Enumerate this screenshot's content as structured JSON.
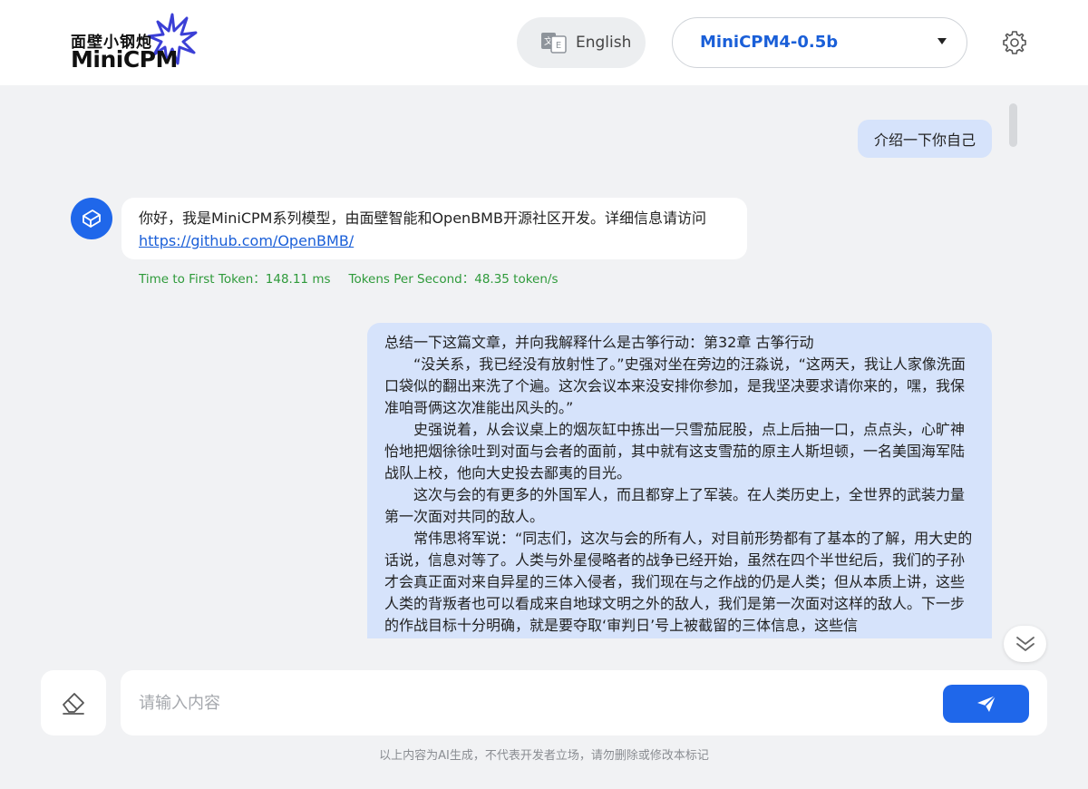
{
  "header": {
    "logo_cn": "面壁小钢炮",
    "logo_en": "MiniCPM",
    "language_label": "English",
    "model_value": "MiniCPM4-0.5b"
  },
  "chat": {
    "user_message_1": "介绍一下你自己",
    "bot_reply_text": "你好，我是MiniCPM系列模型，由面壁智能和OpenBMB开源社区开发。详细信息请访问",
    "bot_reply_link": "https://github.com/OpenBMB/",
    "metric_ttft": "Time to First Token：148.11 ms",
    "metric_tps": "Tokens Per Second：48.35 token/s",
    "user_message_2_paragraphs": [
      "总结一下这篇文章，并向我解释什么是古筝行动：第32章 古筝行动",
      "“没关系，我已经没有放射性了。”史强对坐在旁边的汪淼说，“这两天，我让人家像洗面口袋似的翻出来洗了个遍。这次会议本来没安排你参加，是我坚决要求请你来的，嘿，我保准咱哥俩这次准能出风头的。”",
      "史强说着，从会议桌上的烟灰缸中拣出一只雪茄屁股，点上后抽一口，点点头，心旷神怡地把烟徐徐吐到对面与会者的面前，其中就有这支雪茄的原主人斯坦顿，一名美国海军陆战队上校，他向大史投去鄙夷的目光。",
      "这次与会的有更多的外国军人，而且都穿上了军装。在人类历史上，全世界的武装力量第一次面对共同的敌人。",
      "常伟思将军说：“同志们，这次与会的所有人，对目前形势都有了基本的了解，用大史的话说，信息对等了。人类与外星侵略者的战争已经开始，虽然在四个半世纪后，我们的子孙才会真正面对来自异星的三体入侵者，我们现在与之作战的仍是人类；但从本质上讲，这些人类的背叛者也可以看成来自地球文明之外的敌人，我们是第一次面对这样的敌人。下一步的作战目标十分明确，就是要夺取‘审判日’号上被截留的三体信息，这些信"
    ]
  },
  "input": {
    "placeholder": "请输入内容"
  },
  "footer": {
    "disclaimer": "以上内容为AI生成，不代表开发者立场，请勿删除或修改本标记"
  },
  "colors": {
    "accent": "#1f67ea",
    "user_bubble": "#d6e3fb",
    "metric_green": "#2e9a3a",
    "background": "#f1f2f4"
  },
  "icons": {
    "language": "translate-icon",
    "settings": "gear-icon",
    "avatar": "minicpm-cube-icon",
    "scroll_down": "double-chevron-down-icon",
    "clear": "eraser-icon",
    "send": "paper-plane-icon"
  }
}
